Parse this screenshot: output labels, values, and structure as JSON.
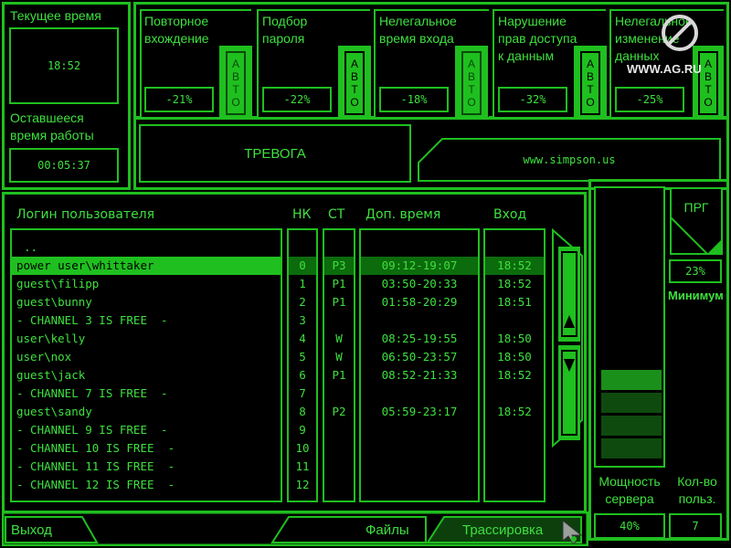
{
  "clock": {
    "current_time_label": "Текущее время",
    "current_time": "18:52",
    "remaining_label": "Оставшееся время работы",
    "remaining_time": "00:05:37"
  },
  "alerts": [
    {
      "title": "Повторное вхождение",
      "value": "-21%",
      "auto": "АВТО"
    },
    {
      "title": "Подбор пароля",
      "value": "-22%",
      "auto": "АВТО"
    },
    {
      "title": "Нелегальное время входа",
      "value": "-18%",
      "auto": "АВТО"
    },
    {
      "title": "Нарушение прав доступа к данным",
      "value": "-32%",
      "auto": "АВТО"
    },
    {
      "title": "Нелегальное изменение данных",
      "value": "-25%",
      "auto": "АВТО"
    }
  ],
  "alarm": {
    "label": "ТРЕВОГА",
    "url": "www.simpson.us"
  },
  "logo": {
    "text": "WWW.AG.RU"
  },
  "table": {
    "headers": {
      "login": "Логин пользователя",
      "nk": "НК",
      "st": "СТ",
      "time": "Доп. время",
      "entry": "Вход"
    },
    "parent_dir": "..",
    "rows": [
      {
        "login": "power user\\whittaker",
        "nk": "0",
        "st": "P3",
        "time": "09:12-19:07",
        "entry": "18:52"
      },
      {
        "login": "guest\\filipp",
        "nk": "1",
        "st": "P1",
        "time": "03:50-20:33",
        "entry": "18:52"
      },
      {
        "login": "guest\\bunny",
        "nk": "2",
        "st": "P1",
        "time": "01:58-20:29",
        "entry": "18:51"
      },
      {
        "login": "- CHANNEL 3 IS FREE  -",
        "nk": "3",
        "st": "",
        "time": "",
        "entry": ""
      },
      {
        "login": "user\\kelly",
        "nk": "4",
        "st": "W",
        "time": "08:25-19:55",
        "entry": "18:50"
      },
      {
        "login": "user\\nox",
        "nk": "5",
        "st": "W",
        "time": "06:50-23:57",
        "entry": "18:50"
      },
      {
        "login": "guest\\jack",
        "nk": "6",
        "st": "P1",
        "time": "08:52-21:33",
        "entry": "18:52"
      },
      {
        "login": "- CHANNEL 7 IS FREE  -",
        "nk": "7",
        "st": "",
        "time": "",
        "entry": ""
      },
      {
        "login": "guest\\sandy",
        "nk": "8",
        "st": "P2",
        "time": "05:59-23:17",
        "entry": "18:52"
      },
      {
        "login": "- CHANNEL 9 IS FREE  -",
        "nk": "9",
        "st": "",
        "time": "",
        "entry": ""
      },
      {
        "login": "- CHANNEL 10 IS FREE  -",
        "nk": "10",
        "st": "",
        "time": "",
        "entry": ""
      },
      {
        "login": "- CHANNEL 11 IS FREE  -",
        "nk": "11",
        "st": "",
        "time": "",
        "entry": ""
      },
      {
        "login": "- CHANNEL 12 IS FREE  -",
        "nk": "12",
        "st": "",
        "time": "",
        "entry": ""
      }
    ],
    "selected_index": 0
  },
  "side": {
    "prg_label": "ПРГ",
    "min_value": "23%",
    "min_label": "Минимум",
    "power_label": "Мощность сервера",
    "power_value": "40%",
    "users_label": "Кол-во польз.",
    "users_value": "7",
    "power_level": 0.4
  },
  "bottom": {
    "exit": "Выход",
    "files": "Файлы",
    "trace": "Трассировка"
  },
  "colors": {
    "primary": "#1fbf1f",
    "text": "#3ee03e",
    "bg": "#000000"
  }
}
